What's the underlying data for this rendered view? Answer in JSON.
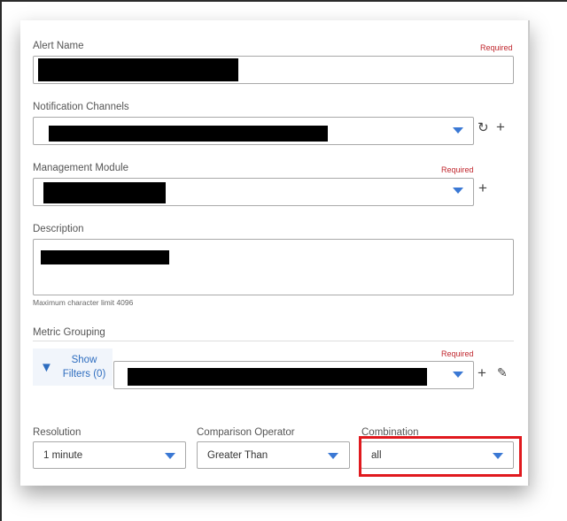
{
  "form": {
    "alert_name": {
      "label": "Alert Name",
      "required": "Required"
    },
    "notification_channels": {
      "label": "Notification Channels"
    },
    "management_module": {
      "label": "Management Module",
      "required": "Required"
    },
    "description": {
      "label": "Description",
      "hint": "Maximum character limit 4096"
    },
    "metric_grouping": {
      "label": "Metric Grouping",
      "required": "Required",
      "show_filters_line1": "Show",
      "show_filters_line2": "Filters (0)"
    },
    "resolution": {
      "label": "Resolution",
      "value": "1 minute"
    },
    "comparison_operator": {
      "label": "Comparison Operator",
      "value": "Greater Than"
    },
    "combination": {
      "label": "Combination",
      "value": "all"
    }
  },
  "colors": {
    "accent": "#3a78d4",
    "required": "#c0262d",
    "highlight": "#e0191e"
  }
}
